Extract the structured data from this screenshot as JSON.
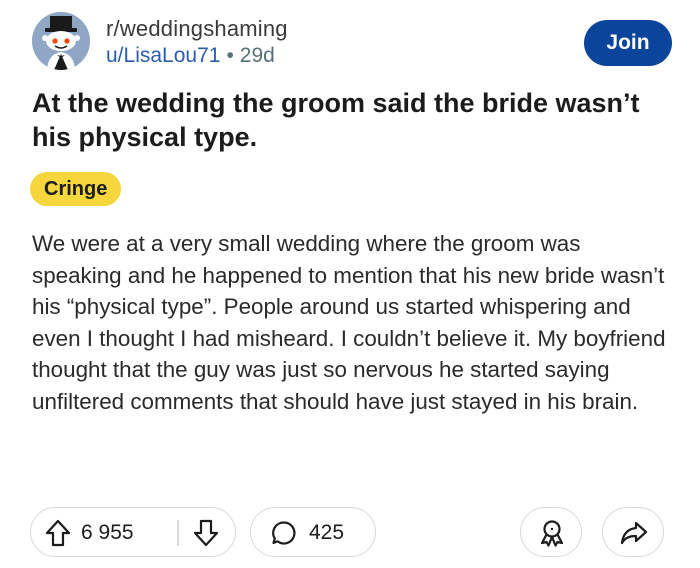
{
  "post": {
    "subreddit": "r/weddingshaming",
    "author": "u/LisaLou71",
    "separator": "•",
    "age": "29d",
    "join_label": "Join",
    "title": "At the wedding the groom said the bride wasn’t his physical type.",
    "flair": "Cringe",
    "body": "We were at a very small wedding where the groom was speaking and he happened to mention that his new bride wasn’t his “physical type”. People around us started whispering and even I thought I had misheard. I couldn’t believe it. My boyfriend thought that the guy was just so nervous he started saying unfiltered comments that should have just stayed in his brain."
  },
  "actions": {
    "upvote_count": "6 955",
    "comment_count": "425"
  },
  "icons": {
    "avatar": "snoo-groom-avatar",
    "upvote": "arrow-up-icon",
    "downvote": "arrow-down-icon",
    "comment": "speech-bubble-icon",
    "award": "award-icon",
    "share": "share-arrow-icon"
  },
  "colors": {
    "join_button": "#0a449b",
    "flair_bg": "#f5d63d",
    "author_link": "#2a5db0",
    "border": "#d6dadc"
  }
}
